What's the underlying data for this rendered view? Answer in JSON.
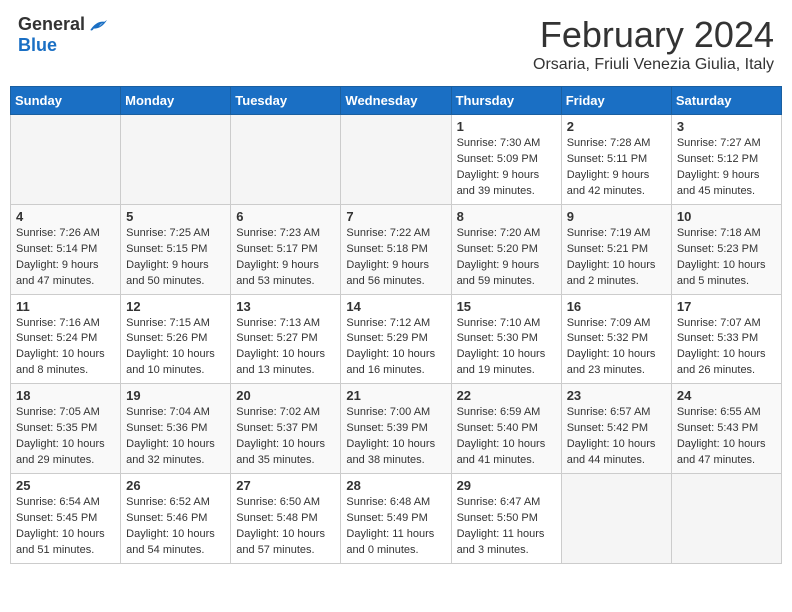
{
  "header": {
    "logo_general": "General",
    "logo_blue": "Blue",
    "month_title": "February 2024",
    "location": "Orsaria, Friuli Venezia Giulia, Italy"
  },
  "weekdays": [
    "Sunday",
    "Monday",
    "Tuesday",
    "Wednesday",
    "Thursday",
    "Friday",
    "Saturday"
  ],
  "weeks": [
    [
      {
        "day": "",
        "info": ""
      },
      {
        "day": "",
        "info": ""
      },
      {
        "day": "",
        "info": ""
      },
      {
        "day": "",
        "info": ""
      },
      {
        "day": "1",
        "info": "Sunrise: 7:30 AM\nSunset: 5:09 PM\nDaylight: 9 hours\nand 39 minutes."
      },
      {
        "day": "2",
        "info": "Sunrise: 7:28 AM\nSunset: 5:11 PM\nDaylight: 9 hours\nand 42 minutes."
      },
      {
        "day": "3",
        "info": "Sunrise: 7:27 AM\nSunset: 5:12 PM\nDaylight: 9 hours\nand 45 minutes."
      }
    ],
    [
      {
        "day": "4",
        "info": "Sunrise: 7:26 AM\nSunset: 5:14 PM\nDaylight: 9 hours\nand 47 minutes."
      },
      {
        "day": "5",
        "info": "Sunrise: 7:25 AM\nSunset: 5:15 PM\nDaylight: 9 hours\nand 50 minutes."
      },
      {
        "day": "6",
        "info": "Sunrise: 7:23 AM\nSunset: 5:17 PM\nDaylight: 9 hours\nand 53 minutes."
      },
      {
        "day": "7",
        "info": "Sunrise: 7:22 AM\nSunset: 5:18 PM\nDaylight: 9 hours\nand 56 minutes."
      },
      {
        "day": "8",
        "info": "Sunrise: 7:20 AM\nSunset: 5:20 PM\nDaylight: 9 hours\nand 59 minutes."
      },
      {
        "day": "9",
        "info": "Sunrise: 7:19 AM\nSunset: 5:21 PM\nDaylight: 10 hours\nand 2 minutes."
      },
      {
        "day": "10",
        "info": "Sunrise: 7:18 AM\nSunset: 5:23 PM\nDaylight: 10 hours\nand 5 minutes."
      }
    ],
    [
      {
        "day": "11",
        "info": "Sunrise: 7:16 AM\nSunset: 5:24 PM\nDaylight: 10 hours\nand 8 minutes."
      },
      {
        "day": "12",
        "info": "Sunrise: 7:15 AM\nSunset: 5:26 PM\nDaylight: 10 hours\nand 10 minutes."
      },
      {
        "day": "13",
        "info": "Sunrise: 7:13 AM\nSunset: 5:27 PM\nDaylight: 10 hours\nand 13 minutes."
      },
      {
        "day": "14",
        "info": "Sunrise: 7:12 AM\nSunset: 5:29 PM\nDaylight: 10 hours\nand 16 minutes."
      },
      {
        "day": "15",
        "info": "Sunrise: 7:10 AM\nSunset: 5:30 PM\nDaylight: 10 hours\nand 19 minutes."
      },
      {
        "day": "16",
        "info": "Sunrise: 7:09 AM\nSunset: 5:32 PM\nDaylight: 10 hours\nand 23 minutes."
      },
      {
        "day": "17",
        "info": "Sunrise: 7:07 AM\nSunset: 5:33 PM\nDaylight: 10 hours\nand 26 minutes."
      }
    ],
    [
      {
        "day": "18",
        "info": "Sunrise: 7:05 AM\nSunset: 5:35 PM\nDaylight: 10 hours\nand 29 minutes."
      },
      {
        "day": "19",
        "info": "Sunrise: 7:04 AM\nSunset: 5:36 PM\nDaylight: 10 hours\nand 32 minutes."
      },
      {
        "day": "20",
        "info": "Sunrise: 7:02 AM\nSunset: 5:37 PM\nDaylight: 10 hours\nand 35 minutes."
      },
      {
        "day": "21",
        "info": "Sunrise: 7:00 AM\nSunset: 5:39 PM\nDaylight: 10 hours\nand 38 minutes."
      },
      {
        "day": "22",
        "info": "Sunrise: 6:59 AM\nSunset: 5:40 PM\nDaylight: 10 hours\nand 41 minutes."
      },
      {
        "day": "23",
        "info": "Sunrise: 6:57 AM\nSunset: 5:42 PM\nDaylight: 10 hours\nand 44 minutes."
      },
      {
        "day": "24",
        "info": "Sunrise: 6:55 AM\nSunset: 5:43 PM\nDaylight: 10 hours\nand 47 minutes."
      }
    ],
    [
      {
        "day": "25",
        "info": "Sunrise: 6:54 AM\nSunset: 5:45 PM\nDaylight: 10 hours\nand 51 minutes."
      },
      {
        "day": "26",
        "info": "Sunrise: 6:52 AM\nSunset: 5:46 PM\nDaylight: 10 hours\nand 54 minutes."
      },
      {
        "day": "27",
        "info": "Sunrise: 6:50 AM\nSunset: 5:48 PM\nDaylight: 10 hours\nand 57 minutes."
      },
      {
        "day": "28",
        "info": "Sunrise: 6:48 AM\nSunset: 5:49 PM\nDaylight: 11 hours\nand 0 minutes."
      },
      {
        "day": "29",
        "info": "Sunrise: 6:47 AM\nSunset: 5:50 PM\nDaylight: 11 hours\nand 3 minutes."
      },
      {
        "day": "",
        "info": ""
      },
      {
        "day": "",
        "info": ""
      }
    ]
  ]
}
